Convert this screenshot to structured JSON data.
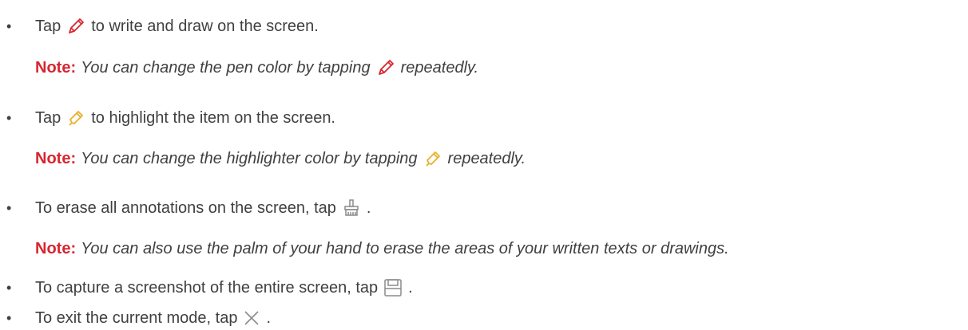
{
  "colors": {
    "text": "#404040",
    "note_label": "#d62630",
    "pen_icon": "#d62630",
    "highlighter_icon": "#e8b02a",
    "gray_icon": "#8c8c8c"
  },
  "items": [
    {
      "bullet": "•",
      "before": "Tap",
      "icon": "pen-icon",
      "after": "to write and draw on the screen.",
      "note": {
        "label": "Note:",
        "before": "You can change the pen color by tapping",
        "icon": "pen-icon",
        "after": "repeatedly."
      }
    },
    {
      "bullet": "•",
      "before": "Tap",
      "icon": "highlighter-icon",
      "after": "to highlight the item on the screen.",
      "note": {
        "label": "Note:",
        "before": "You can change the highlighter color by tapping",
        "icon": "highlighter-icon",
        "after": "repeatedly."
      }
    },
    {
      "bullet": "•",
      "before": "To erase all annotations on the screen, tap",
      "icon": "eraser-icon",
      "after": ".",
      "note": {
        "label": "Note:",
        "before": "You can also use the palm of your hand to erase the areas of your written texts or drawings.",
        "icon": "",
        "after": ""
      }
    },
    {
      "bullet": "•",
      "before": "To capture a screenshot of the entire screen, tap",
      "icon": "save-icon",
      "after": "."
    },
    {
      "bullet": "•",
      "before": "To exit the current mode, tap",
      "icon": "close-icon",
      "after": "."
    }
  ]
}
